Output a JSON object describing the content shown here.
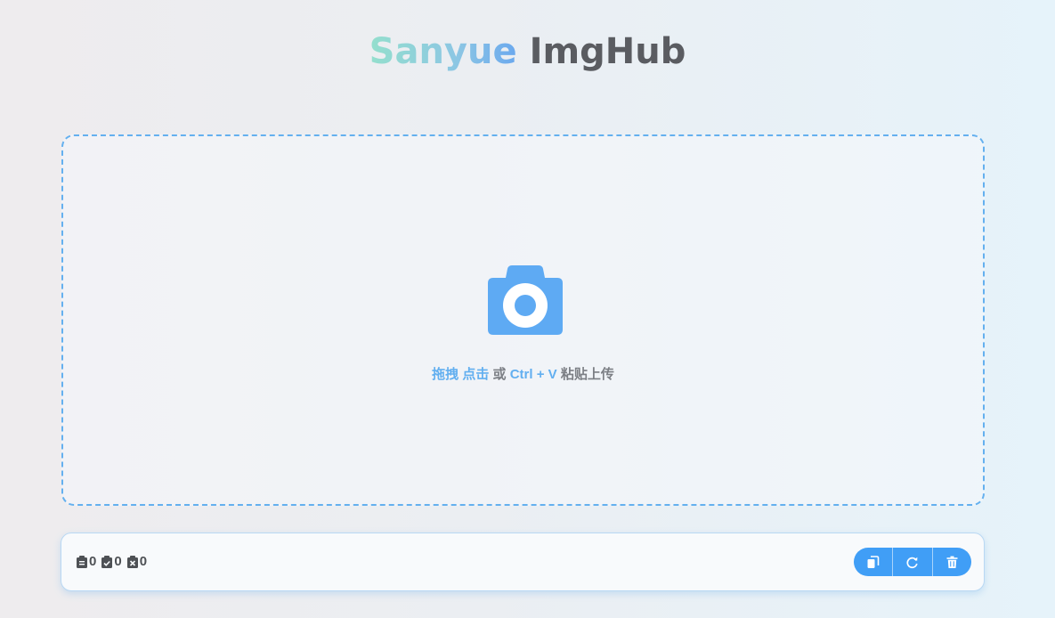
{
  "header": {
    "brand": "Sanyue",
    "app_name": "ImgHub"
  },
  "dropzone": {
    "icon": "camera-icon",
    "hint": {
      "drag": "拖拽",
      "click": "点击",
      "or": "或",
      "shortcut": "Ctrl + V",
      "paste_upload": "粘贴上传"
    }
  },
  "toolbar": {
    "stats": [
      {
        "icon": "clipboard-list-icon",
        "value": "0"
      },
      {
        "icon": "clipboard-check-icon",
        "value": "0"
      },
      {
        "icon": "clipboard-x-icon",
        "value": "0"
      }
    ],
    "actions": [
      {
        "icon": "copy-icon"
      },
      {
        "icon": "refresh-icon"
      },
      {
        "icon": "trash-icon"
      }
    ]
  },
  "colors": {
    "accent": "#409ef6",
    "hint_highlight": "#62aff0",
    "dropzone_border": "#64b0ef",
    "text_dark": "#5a5c61"
  }
}
